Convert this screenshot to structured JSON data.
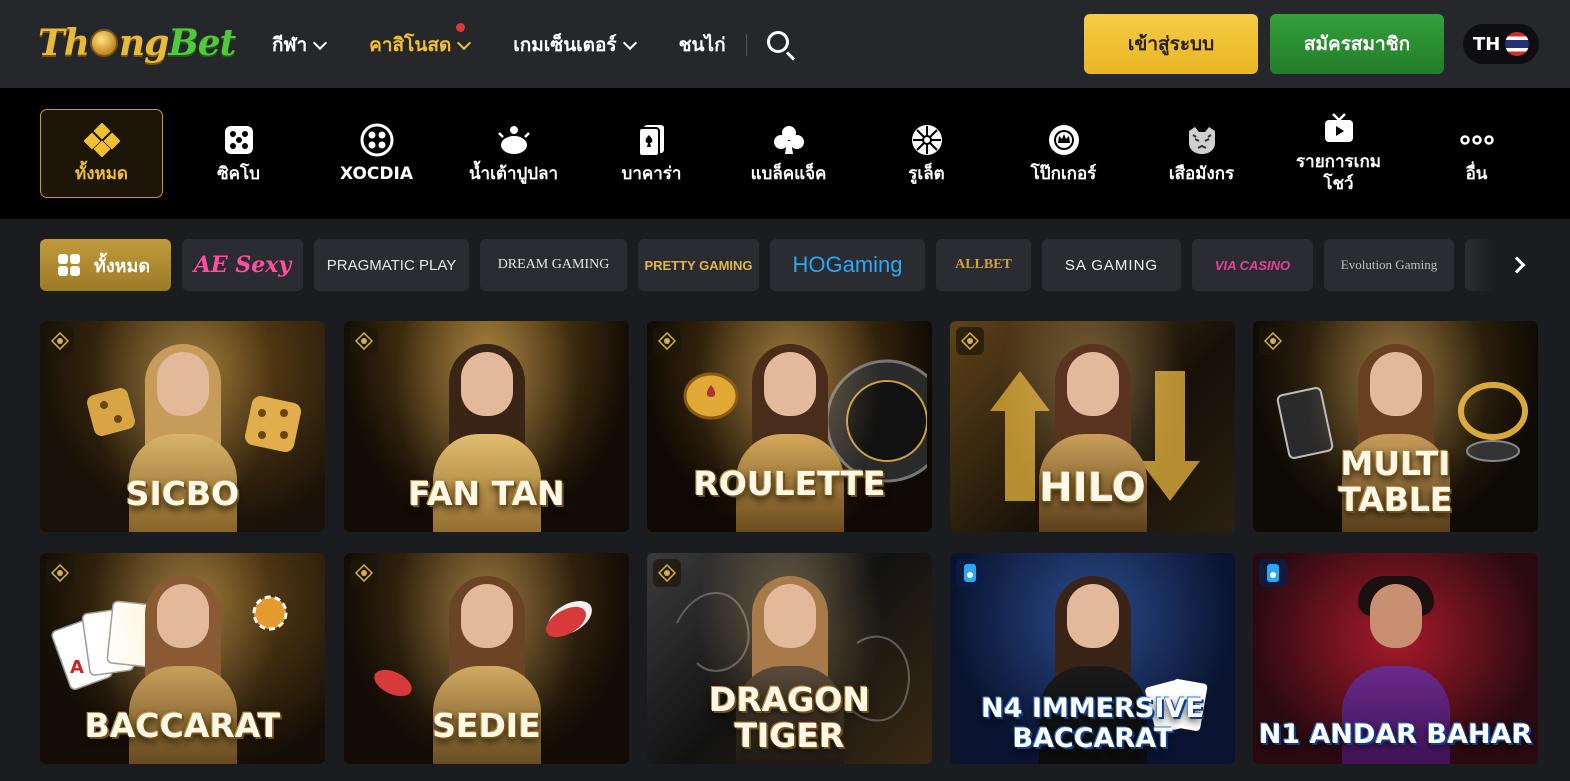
{
  "header": {
    "logo_part1": "Th",
    "logo_part2": "ng",
    "logo_part3": "Bet",
    "nav": [
      {
        "label": "กีฬา",
        "active": false,
        "dot": false
      },
      {
        "label": "คาสิโนสด",
        "active": true,
        "dot": true
      },
      {
        "label": "เกมเซ็นเตอร์",
        "active": false,
        "dot": false
      },
      {
        "label": "ชนไก่",
        "active": false,
        "dot": false
      }
    ],
    "login_label": "เข้าสู่ระบบ",
    "register_label": "สมัครสมาชิก",
    "language_code": "TH"
  },
  "categories": [
    {
      "label": "ทั้งหมด",
      "icon": "clover-icon",
      "active": true
    },
    {
      "label": "ซิคโบ",
      "icon": "dice-icon"
    },
    {
      "label": "XOCDIA",
      "icon": "xocdia-icon"
    },
    {
      "label": "น้ำเต้าปูปลา",
      "icon": "gourd-icon"
    },
    {
      "label": "บาคาร่า",
      "icon": "cards-icon"
    },
    {
      "label": "แบล็คแจ็ค",
      "icon": "club-icon"
    },
    {
      "label": "รูเล็ต",
      "icon": "roulette-icon"
    },
    {
      "label": "โป๊กเกอร์",
      "icon": "poker-chip-icon"
    },
    {
      "label": "เสือมังกร",
      "icon": "tiger-icon"
    },
    {
      "label": "รายการเกม",
      "label2": "โชว์",
      "icon": "tv-icon"
    },
    {
      "label": "อื่น",
      "icon": "more-icon"
    }
  ],
  "providers": {
    "all_label": "ทั้งหมด",
    "items": [
      {
        "name": "AE Sexy"
      },
      {
        "name": "PRAGMATIC PLAY"
      },
      {
        "name": "DREAM GAMING"
      },
      {
        "name": "PRETTY GAMING"
      },
      {
        "name": "HOGaming"
      },
      {
        "name": "ALLBET"
      },
      {
        "name": "SA GAMING"
      },
      {
        "name": "VIA CASINO"
      },
      {
        "name": "Evolution Gaming"
      }
    ]
  },
  "games": [
    {
      "title": "SICBO",
      "provider_badge": "pretty-badge-icon"
    },
    {
      "title": "FAN TAN",
      "provider_badge": "pretty-badge-icon"
    },
    {
      "title": "ROULETTE",
      "provider_badge": "pretty-badge-icon"
    },
    {
      "title": "HILO",
      "provider_badge": "pretty-badge-icon"
    },
    {
      "title": "MULTI\nTABLE",
      "provider_badge": "pretty-badge-icon"
    },
    {
      "title": "BACCARAT",
      "provider_badge": "pretty-badge-icon"
    },
    {
      "title": "SEDIE",
      "provider_badge": "pretty-badge-icon"
    },
    {
      "title": "DRAGON\nTIGER",
      "provider_badge": "pretty-badge-icon"
    },
    {
      "title": "N4 IMMERSIVE\nBACCARAT",
      "provider_badge": "ho-badge-icon"
    },
    {
      "title": "N1 ANDAR BAHAR",
      "provider_badge": "ho-badge-icon"
    }
  ],
  "colors": {
    "accent_gold": "#f0bf33",
    "register_green": "#2f9235",
    "background": "#1b1c20",
    "header_bg": "#26272b"
  }
}
